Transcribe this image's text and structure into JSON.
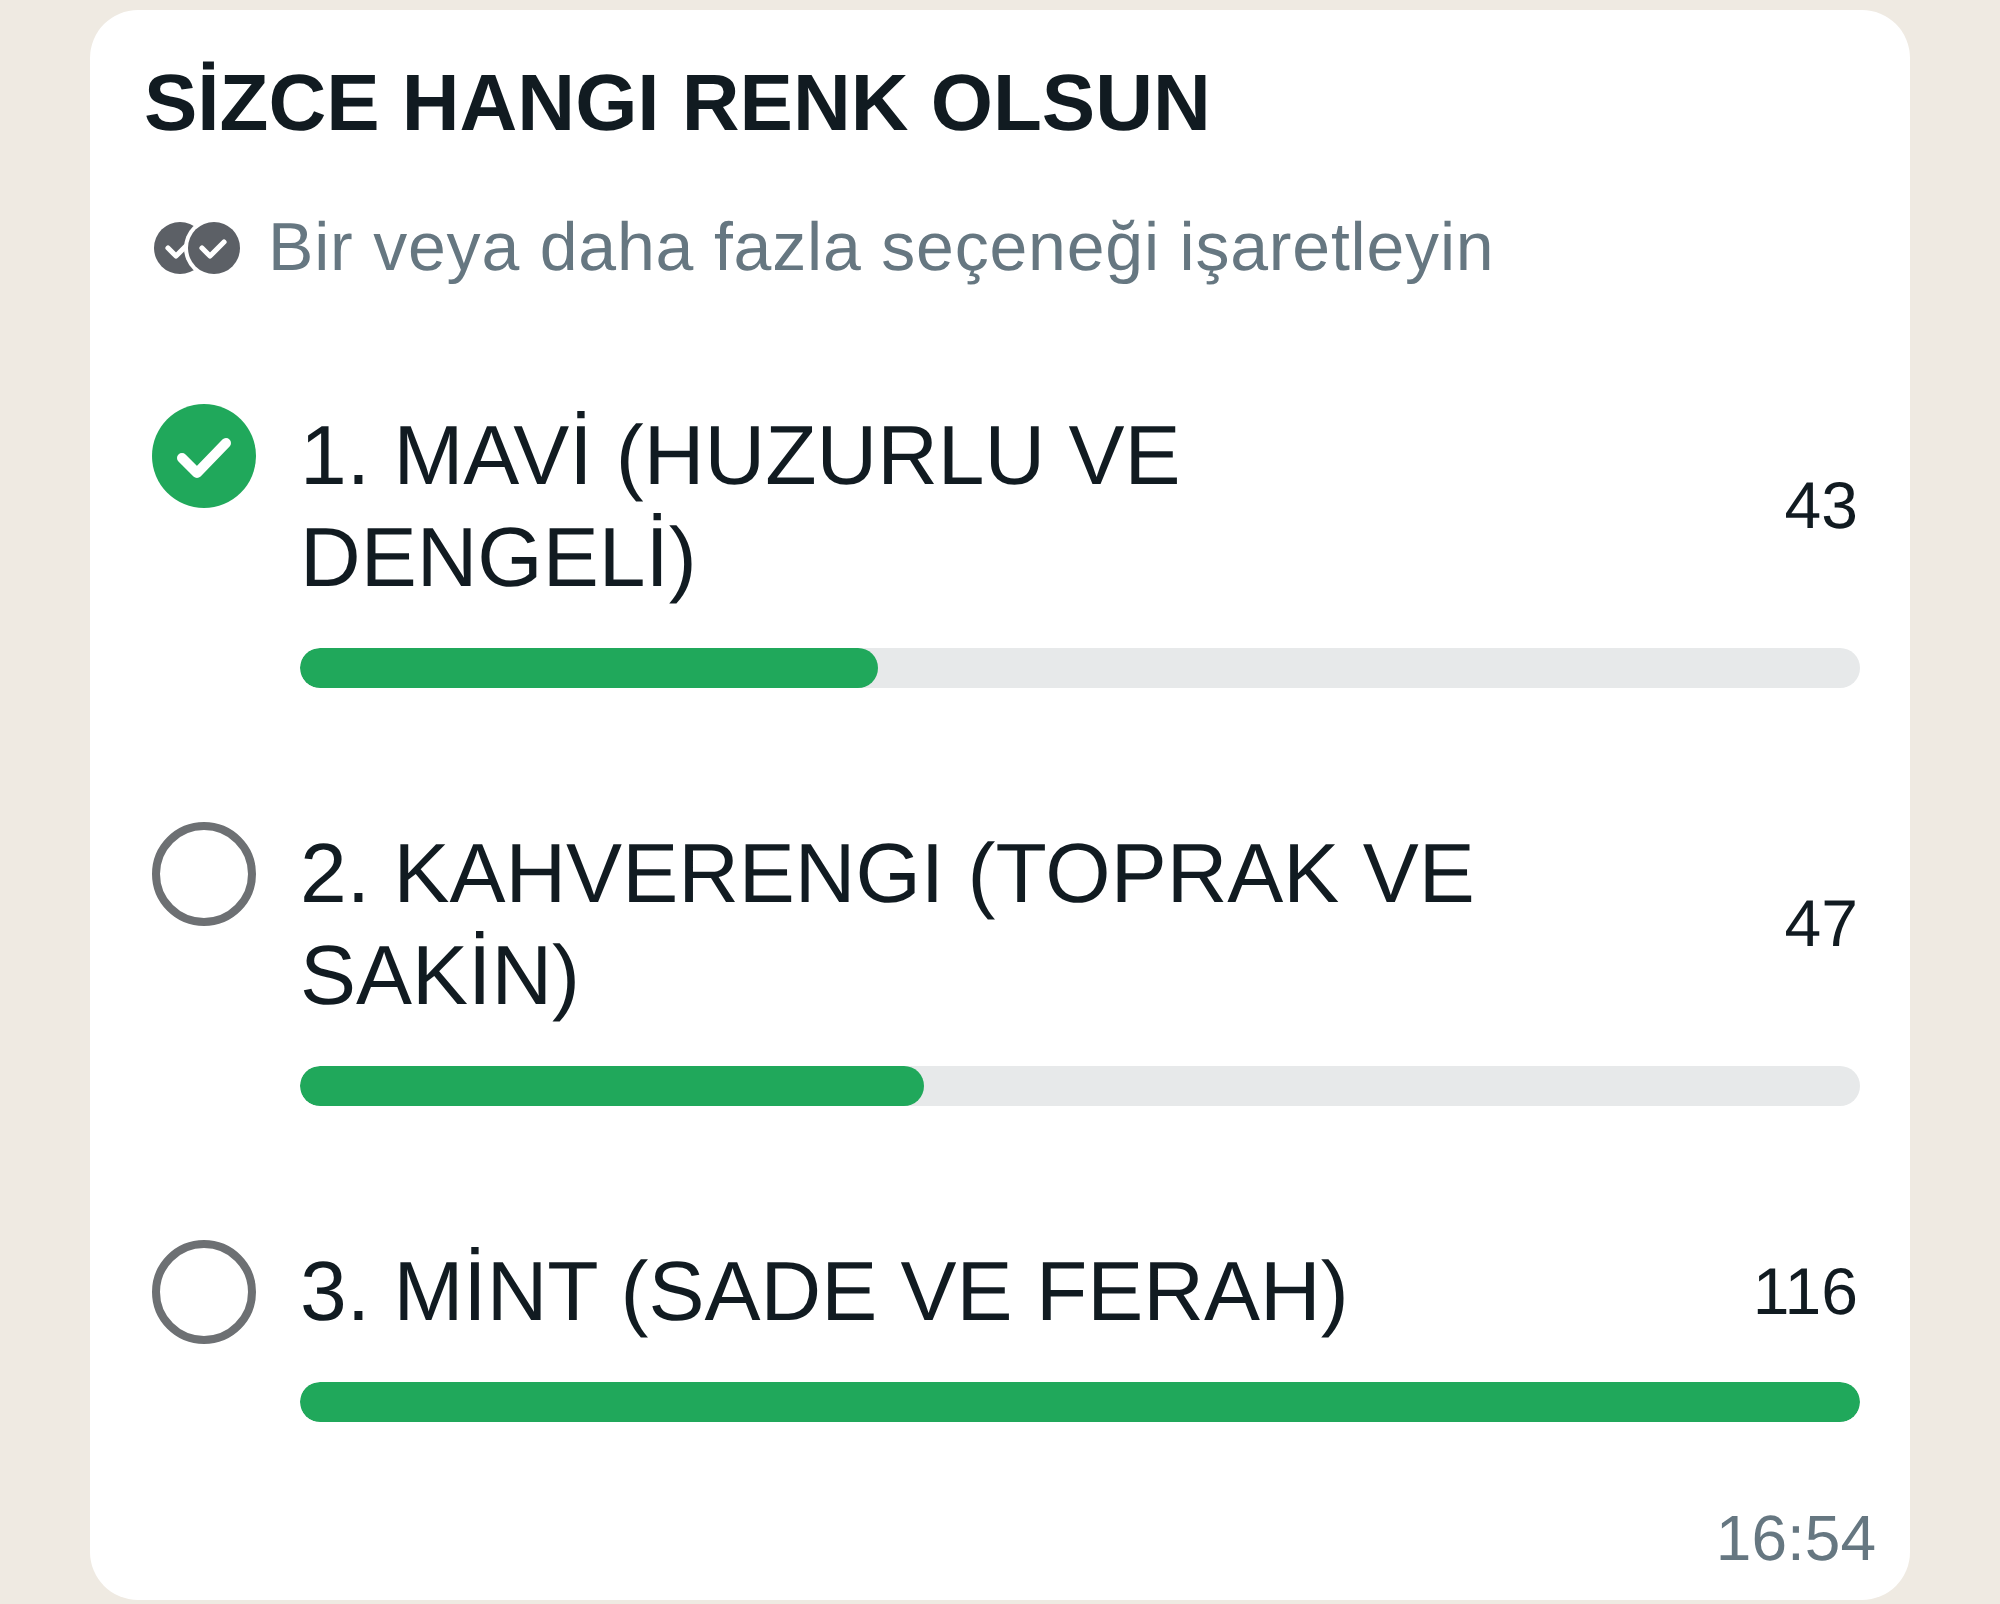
{
  "poll": {
    "title": "SİZCE HANGI RENK OLSUN",
    "instruction": "Bir veya daha fazla seçeneği işaretleyin",
    "options": [
      {
        "label": "1. MAVİ (HUZURLU VE DENGELİ)",
        "selected": true,
        "votes": "43",
        "level": 0.37
      },
      {
        "label": "2. KAHVERENGI (TOPRAK VE SAKİN)",
        "selected": false,
        "votes": "47",
        "level": 0.4
      },
      {
        "label": "3. MİNT (SADE VE FERAH)",
        "selected": false,
        "votes": "116",
        "level": 1
      }
    ],
    "time": "16:54"
  }
}
